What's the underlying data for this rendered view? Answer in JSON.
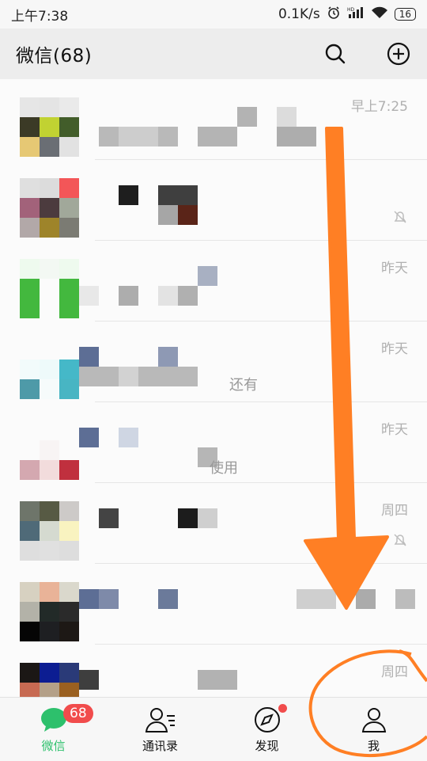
{
  "status": {
    "time": "上午7:38",
    "speed": "0.1K/s",
    "network": "HD",
    "battery": "16"
  },
  "header": {
    "title": "微信(68)"
  },
  "chats": [
    {
      "time": "早上7:25",
      "snippet": ""
    },
    {
      "time": "",
      "snippet": ""
    },
    {
      "time": "昨天",
      "snippet": ""
    },
    {
      "time": "昨天",
      "snippet": "还有"
    },
    {
      "time": "昨天",
      "snippet": "使用"
    },
    {
      "time": "周四",
      "snippet": ""
    },
    {
      "time": "",
      "snippet": ""
    },
    {
      "time": "周四",
      "snippet": ""
    }
  ],
  "tabs": [
    {
      "label": "微信",
      "badge": "68"
    },
    {
      "label": "通讯录"
    },
    {
      "label": "发现"
    },
    {
      "label": "我"
    }
  ],
  "colors": {
    "accent": "#2dc06c",
    "badge": "#f14c4c",
    "annotation": "#ff7f24"
  }
}
